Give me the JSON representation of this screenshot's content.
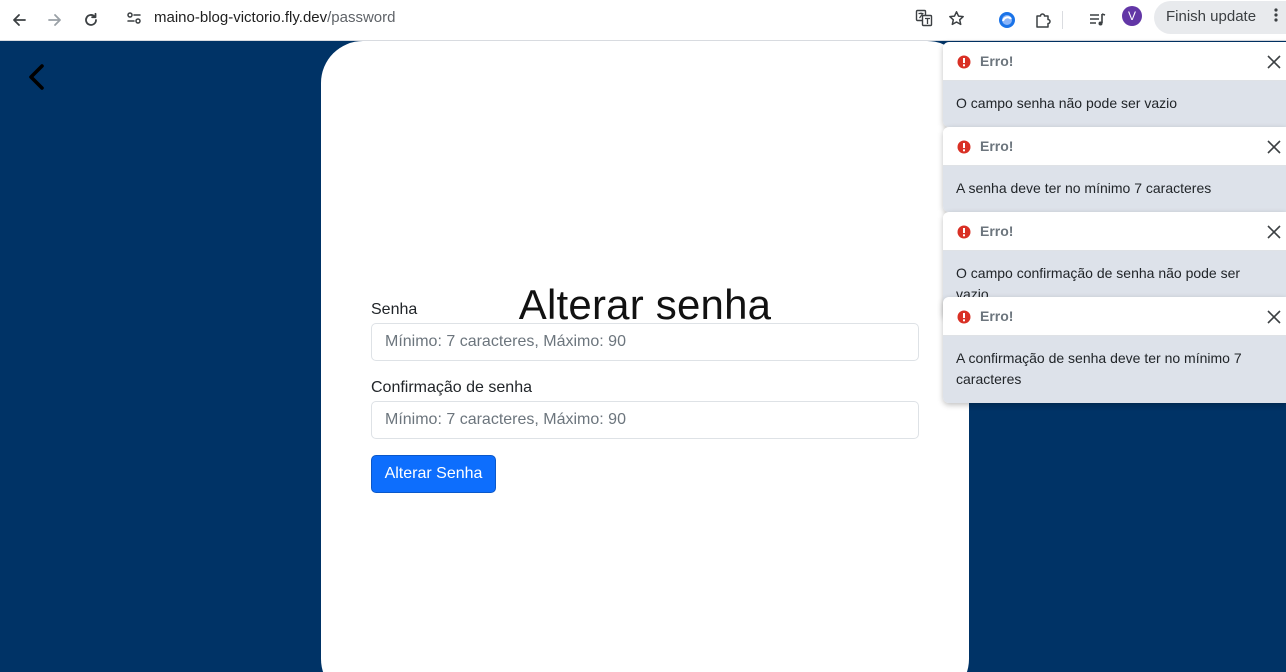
{
  "browser": {
    "url_host": "maino-blog-victorio.fly.dev",
    "url_path": "/password",
    "profile_initial": "V",
    "finish_update_label": "Finish update"
  },
  "page": {
    "title": "Alterar senha",
    "password_label": "Senha",
    "password_placeholder": "Mínimo: 7 caracteres, Máximo: 90",
    "password_value": "",
    "confirm_label": "Confirmação de senha",
    "confirm_placeholder": "Mínimo: 7 caracteres, Máximo: 90",
    "confirm_value": "",
    "submit_label": "Alterar Senha"
  },
  "toasts": [
    {
      "title": "Erro!",
      "message": "O campo senha não pode ser vazio"
    },
    {
      "title": "Erro!",
      "message": "A senha deve ter no mínimo 7 caracteres"
    },
    {
      "title": "Erro!",
      "message": "O campo confirmação de senha não pode ser vazio"
    },
    {
      "title": "Erro!",
      "message": "A confirmação de senha deve ter no mínimo 7 caracteres"
    }
  ],
  "colors": {
    "page_background": "#003366",
    "primary_button": "#0d6efd",
    "error_icon": "#d93025",
    "toast_body": "#dde2ea"
  }
}
